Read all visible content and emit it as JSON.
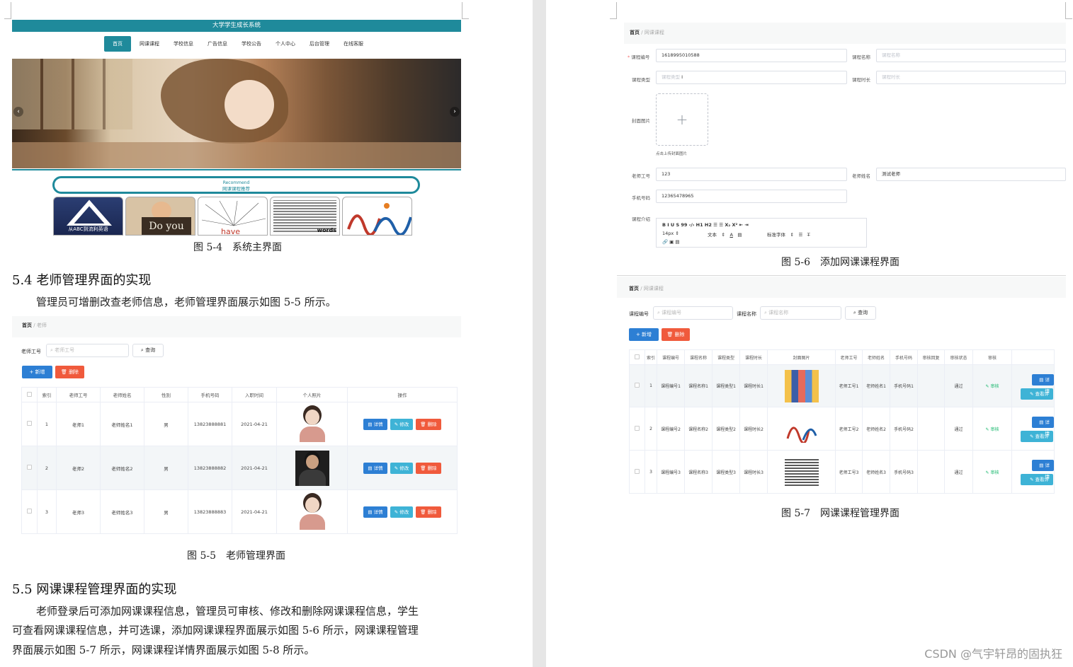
{
  "colors": {
    "accent_teal": "#1f8a9b",
    "primary_blue": "#2d7fd4",
    "danger_red": "#f05a3c",
    "info_teal": "#3eb3d6"
  },
  "left": {
    "fig54": {
      "site_title": "大学学生成长系统",
      "nav": [
        "首页",
        "网课课程",
        "学校信息",
        "广告信息",
        "学校公告",
        "个人中心",
        "后台管理",
        "在线客服"
      ],
      "recommend_en": "Recommend",
      "recommend_cn": "网课课程推荐",
      "thumb1_text": "从ABC到流利英语",
      "thumb2_text": "Do you",
      "thumb3_text": "have",
      "thumb4_text": "words",
      "caption": "图 5-4　系统主界面"
    },
    "section54": {
      "heading": "5.4 老师管理界面的实现",
      "para": "管理员可增删改查老师信息，老师管理界面展示如图 5-5 所示。"
    },
    "fig55": {
      "breadcrumb_home": "首页",
      "breadcrumb_sep": "/",
      "breadcrumb_current": "老师",
      "search_label": "老师工号",
      "search_placeholder": "老师工号",
      "query_btn": "查询",
      "add_btn": "+ 新增",
      "delete_btn": "删除",
      "columns": [
        "",
        "索引",
        "老师工号",
        "老师姓名",
        "性别",
        "手机号码",
        "入职时间",
        "个人照片",
        "操作"
      ],
      "rows": [
        {
          "index": "1",
          "no": "老师1",
          "name": "老师姓名1",
          "gender": "男",
          "phone": "13823888881",
          "date": "2021-04-21"
        },
        {
          "index": "2",
          "no": "老师2",
          "name": "老师姓名2",
          "gender": "男",
          "phone": "13823888882",
          "date": "2021-04-21"
        },
        {
          "index": "3",
          "no": "老师3",
          "name": "老师姓名3",
          "gender": "男",
          "phone": "13823888883",
          "date": "2021-04-21"
        }
      ],
      "row_btn_detail": "详情",
      "row_btn_edit": "修改",
      "row_btn_delete": "删除",
      "caption": "图 5-5　老师管理界面"
    },
    "section55": {
      "heading": "5.5 网课课程管理界面的实现",
      "para_line1": "老师登录后可添加网课课程信息，管理员可审核、修改和删除网课课程信息，学生",
      "para_line2": "可查看网课课程信息，并可选课，添加网课课程界面展示如图 5-6 所示，网课课程管理",
      "para_line3": "界面展示如图 5-7 所示，网课课程详情界面展示如图 5-8 所示。"
    }
  },
  "right": {
    "fig56": {
      "breadcrumb_home": "首页",
      "breadcrumb_sep": "/",
      "breadcrumb_current": "网课课程",
      "course_no_label": "课程编号",
      "course_no_value": "1618995010588",
      "course_name_label": "课程名称",
      "course_name_placeholder": "课程名称",
      "course_type_label": "课程类型",
      "course_type_placeholder": "课程类型",
      "course_hours_label": "课程时长",
      "course_hours_placeholder": "课程时长",
      "cover_label": "封面图片",
      "upload_hint": "点击上传封面图片",
      "teacher_no_label": "老师工号",
      "teacher_no_value": "123",
      "teacher_name_label": "老师姓名",
      "teacher_name_value": "测试老师",
      "phone_label": "手机号码",
      "phone_value": "12365478965",
      "intro_label": "课程介绍",
      "toolbar_row1": "B   I   U   S     99   ‹/›     H1  H2     ☰   ☰     X₂  X²     ⇤  ⇥",
      "toolbar_size": "14px",
      "toolbar_text": "文本",
      "toolbar_font": "标准字体",
      "caption": "图 5-6　添加网课课程界面"
    },
    "fig57": {
      "breadcrumb_home": "首页",
      "breadcrumb_sep": "/",
      "breadcrumb_current": "网课课程",
      "search1_label": "课程编号",
      "search1_placeholder": "课程编号",
      "search2_label": "课程名称",
      "search2_placeholder": "课程名称",
      "query_btn": "查询",
      "add_btn": "+ 新增",
      "delete_btn": "删除",
      "columns": [
        "",
        "索引",
        "课程编号",
        "课程名称",
        "课程类型",
        "课程时长",
        "封面图片",
        "老师工号",
        "老师姓名",
        "手机号码",
        "审核回复",
        "审核状态",
        "审核",
        ""
      ],
      "rows": [
        {
          "index": "1",
          "no": "课程编号1",
          "name": "课程名称1",
          "type": "课程类型1",
          "hours": "课程时长1",
          "tno": "老师工号1",
          "tname": "老师姓名1",
          "phone": "手机号码1",
          "status": "通过",
          "audit": "审核"
        },
        {
          "index": "2",
          "no": "课程编号2",
          "name": "课程名称2",
          "type": "课程类型2",
          "hours": "课程时长2",
          "tno": "老师工号2",
          "tname": "老师姓名2",
          "phone": "手机号码2",
          "status": "通过",
          "audit": "审核"
        },
        {
          "index": "3",
          "no": "课程编号3",
          "name": "课程名称3",
          "type": "课程类型3",
          "hours": "课程时长3",
          "tno": "老师工号3",
          "tname": "老师姓名3",
          "phone": "手机号码3",
          "status": "通过",
          "audit": "审核"
        }
      ],
      "btn_detail": "详情",
      "btn_view": "查看评",
      "caption": "图 5-7　网课课程管理界面"
    }
  },
  "watermark": "CSDN @气宇轩昂的固执狂"
}
